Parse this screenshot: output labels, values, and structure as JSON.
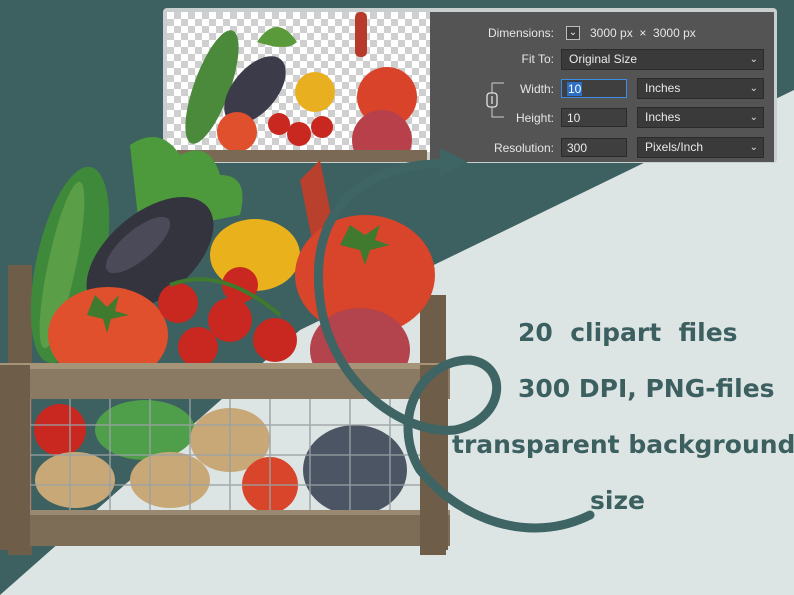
{
  "colors": {
    "dark_teal": "#3d6060",
    "light_bg": "#dde4e4",
    "dialog_bg": "#545454",
    "text_teal": "#3c5f5f"
  },
  "dialog": {
    "dimensions_label": "Dimensions:",
    "dimensions_value": "3000 px  ×  3000 px",
    "fit_to_label": "Fit To:",
    "fit_to_value": "Original Size",
    "width_label": "Width:",
    "width_value": "10",
    "width_unit": "Inches",
    "height_label": "Height:",
    "height_value": "10",
    "height_unit": "Inches",
    "resolution_label": "Resolution:",
    "resolution_value": "300",
    "resolution_unit": "Pixels/Inch",
    "link_icon": "chain-link-icon",
    "chevron_icon": "chevron-down-icon"
  },
  "promo": {
    "line1": "20  clipart  files",
    "line2": "300 DPI, PNG-files",
    "line3": "transparent background",
    "line4": "size"
  }
}
